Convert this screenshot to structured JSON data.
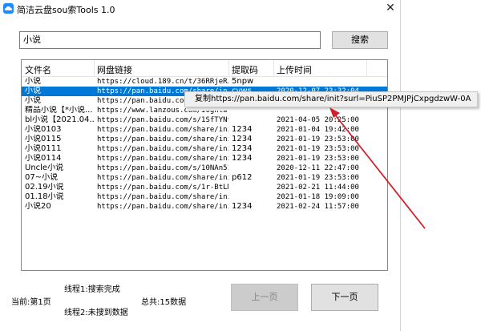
{
  "window": {
    "title": "简洁云盘sou索Tools 1.0",
    "close_label": "✕"
  },
  "search": {
    "value": "小说",
    "button_label": "搜索"
  },
  "table": {
    "headers": [
      "文件名",
      "网盘链接",
      "提取码",
      "上传时间"
    ],
    "rows": [
      [
        "小说",
        "https://cloud.189.cn/t/36RRjeRJ...",
        "5npw",
        ""
      ],
      [
        "小说",
        "https://pan.baidu.com/share/init...",
        "cvws",
        "2020-12-07 23:32:04"
      ],
      [
        "小说",
        "https://pan.baidu.com/share/init...",
        "",
        ""
      ],
      [
        "精品小说【*小说...",
        "https://www.lanzous.com/i0ghtw...",
        "",
        ""
      ],
      [
        "bl小说【2021.04...",
        "https://pan.baidu.com/s/1SfTYNt...",
        "",
        "2021-04-05 20:25:00"
      ],
      [
        "小说0103",
        "https://pan.baidu.com/share/ini...",
        "1234",
        "2021-01-04 19:42:00"
      ],
      [
        "小说0115",
        "https://pan.baidu.com/share/ini...",
        "1234",
        "2021-01-19 23:53:00"
      ],
      [
        "小说0111",
        "https://pan.baidu.com/share/ini...",
        "1234",
        "2021-01-19 23:53:00"
      ],
      [
        "小说0114",
        "https://pan.baidu.com/share/ini...",
        "1234",
        "2021-01-19 23:53:00"
      ],
      [
        "Uncle小说",
        "https://pan.baidu.com/s/10NAn51...",
        "",
        "2020-12-11 22:47:00"
      ],
      [
        "07~小说",
        "https://pan.baidu.com/share/ini...",
        "p612",
        "2021-01-19 23:53:00"
      ],
      [
        "02.19小说",
        "https://pan.baidu.com/s/1r-BtLM...",
        "",
        "2021-02-21 11:44:00"
      ],
      [
        "01.18小说",
        "https://pan.baidu.com/share/ini...",
        "",
        "2021-01-18 19:09:00"
      ],
      [
        "小说20",
        "https://pan.baidu.com/share/ini...",
        "1234",
        "2021-02-24 11:57:00"
      ]
    ],
    "selected_row": 1
  },
  "context_menu": {
    "item_label": "复制https://pan.baidu.com/share/init?surl=PiuSP2PMJPjCxpgdzwW-0A"
  },
  "status": {
    "thread1": "线程1:搜索完成",
    "thread2": "线程2:未搜到数据",
    "current_page": "当前:第1页",
    "total": "总共:15数据"
  },
  "pager": {
    "prev_label": "上一页",
    "next_label": "下一页"
  },
  "colors": {
    "selection": "#0078d7",
    "arrow": "#d0202a",
    "app_icon": "#1a8cff"
  }
}
